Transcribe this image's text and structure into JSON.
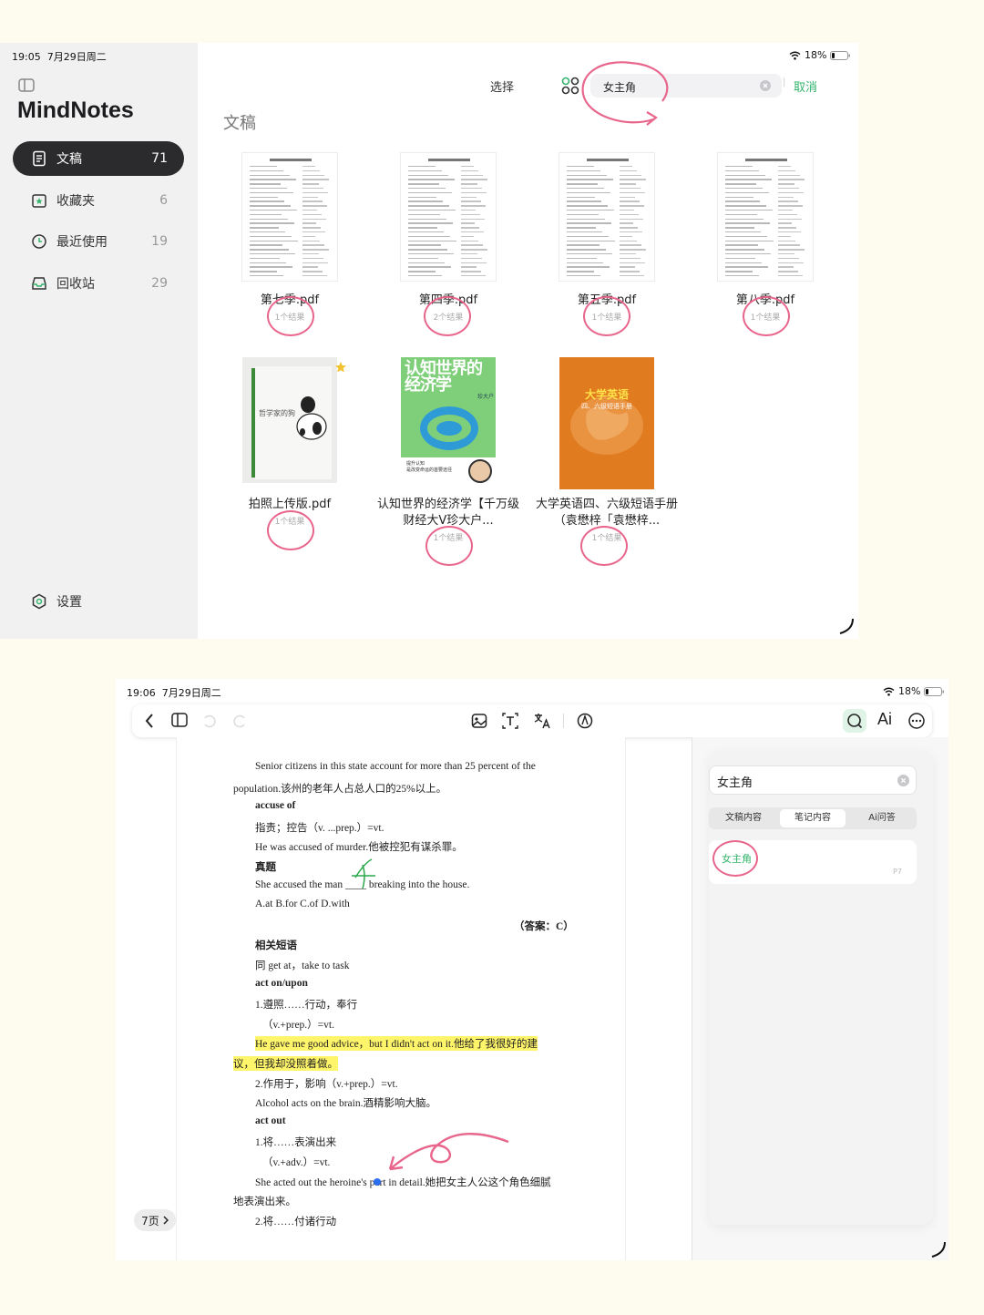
{
  "top": {
    "status": {
      "time": "19:05",
      "date": "7月29日周二",
      "battery": "18%"
    },
    "app_title": "MindNotes",
    "sidebar": [
      {
        "label": "文稿",
        "count": "71",
        "icon": "document-icon",
        "active": true
      },
      {
        "label": "收藏夹",
        "count": "6",
        "icon": "star-folder-icon",
        "active": false
      },
      {
        "label": "最近使用",
        "count": "19",
        "icon": "clock-icon",
        "active": false
      },
      {
        "label": "回收站",
        "count": "29",
        "icon": "trash-tray-icon",
        "active": false
      }
    ],
    "settings_label": "设置",
    "header": {
      "select_label": "选择",
      "search_value": "女主角",
      "cancel_label": "取消"
    },
    "section_title": "文稿",
    "documents": [
      {
        "name": "第七季.pdf",
        "result": "1个结果",
        "cover": "text"
      },
      {
        "name": "第四季.pdf",
        "result": "2个结果",
        "cover": "text"
      },
      {
        "name": "第五季.pdf",
        "result": "1个结果",
        "cover": "text"
      },
      {
        "name": "第八季.pdf",
        "result": "1个结果",
        "cover": "text"
      },
      {
        "name": "拍照上传版.pdf",
        "result": "1个结果",
        "cover": "photo",
        "cover_text": "哲学家的狗",
        "starred": true
      },
      {
        "name": "认知世界的经济学【千万级财经大V珍大户...",
        "result": "1个结果",
        "cover": "green",
        "cover_text": "认知世界的经济学",
        "cover_sub": "提升认知\n是改变命运的首要途径",
        "cover_badge": "珍大户"
      },
      {
        "name": "大学英语四、六级短语手册（袁懋梓「袁懋梓...",
        "result": "1个结果",
        "cover": "orange",
        "cover_text": "大学英语",
        "cover_sub": "四、六级短语手册"
      }
    ]
  },
  "bottom": {
    "status": {
      "time": "19:06",
      "date": "7月29日周二",
      "battery": "18%"
    },
    "toolbar": {
      "ai_label": "Ai"
    },
    "page_indicator": "7页",
    "lines": [
      {
        "text": "Senior citizens in this state account for more than 25 percent of the",
        "indent": 1
      },
      {
        "text": "population.该州的老年人占总人口的25%以上。",
        "indent": 0
      },
      {
        "text": "accuse of",
        "indent": 1,
        "bold": true
      },
      {
        "text": "指责；控告（v. ...prep.）=vt.",
        "indent": 1
      },
      {
        "text": "He was accused of murder.他被控犯有谋杀罪。",
        "indent": 1
      },
      {
        "text": "真题",
        "indent": 1,
        "bold": true
      },
      {
        "text": "She accused the man ____ breaking into the house.",
        "indent": 1
      },
      {
        "text": "A.at          B.for          C.of          D.with",
        "indent": 1
      },
      {
        "text": "（答案：C）",
        "indent": 2,
        "bold": true
      },
      {
        "text": "相关短语",
        "indent": 1,
        "bold": true
      },
      {
        "text": "同   get at，take to task",
        "indent": 1
      },
      {
        "text": "act on/upon",
        "indent": 1,
        "bold": true
      },
      {
        "text": "1.遵照……行动，奉行",
        "indent": 1
      },
      {
        "text": "（v.+prep.）=vt.",
        "indent": 3
      },
      {
        "text": "He gave me good advice，but I didn't act on it.他给了我很好的建",
        "indent": 1,
        "highlight": true
      },
      {
        "text": "议，但我却没照着做。",
        "indent": 0,
        "highlight": true
      },
      {
        "text": "2.作用于，影响（v.+prep.）=vt.",
        "indent": 1
      },
      {
        "text": "Alcohol acts on the brain.酒精影响大脑。",
        "indent": 1
      },
      {
        "text": "act out",
        "indent": 1,
        "bold": true
      },
      {
        "text": "1.将……表演出来",
        "indent": 1
      },
      {
        "text": "（v.+adv.）=vt.",
        "indent": 3
      },
      {
        "text": "She acted out the heroine's part in detail.她把女主人公这个角色细腻",
        "indent": 1
      },
      {
        "text": "地表演出来。",
        "indent": 0
      },
      {
        "text": "2.将……付诸行动",
        "indent": 1
      }
    ],
    "search": {
      "value": "女主角",
      "tabs": [
        "文稿内容",
        "笔记内容",
        "Ai问答"
      ],
      "active_tab": 1,
      "result_text": "女主角",
      "result_page": "P7"
    }
  },
  "colors": {
    "accent_green": "#33b36b",
    "annotation_pink": "#e8658c",
    "sidebar_active": "#2b2b2d",
    "highlight": "#fff56a"
  }
}
